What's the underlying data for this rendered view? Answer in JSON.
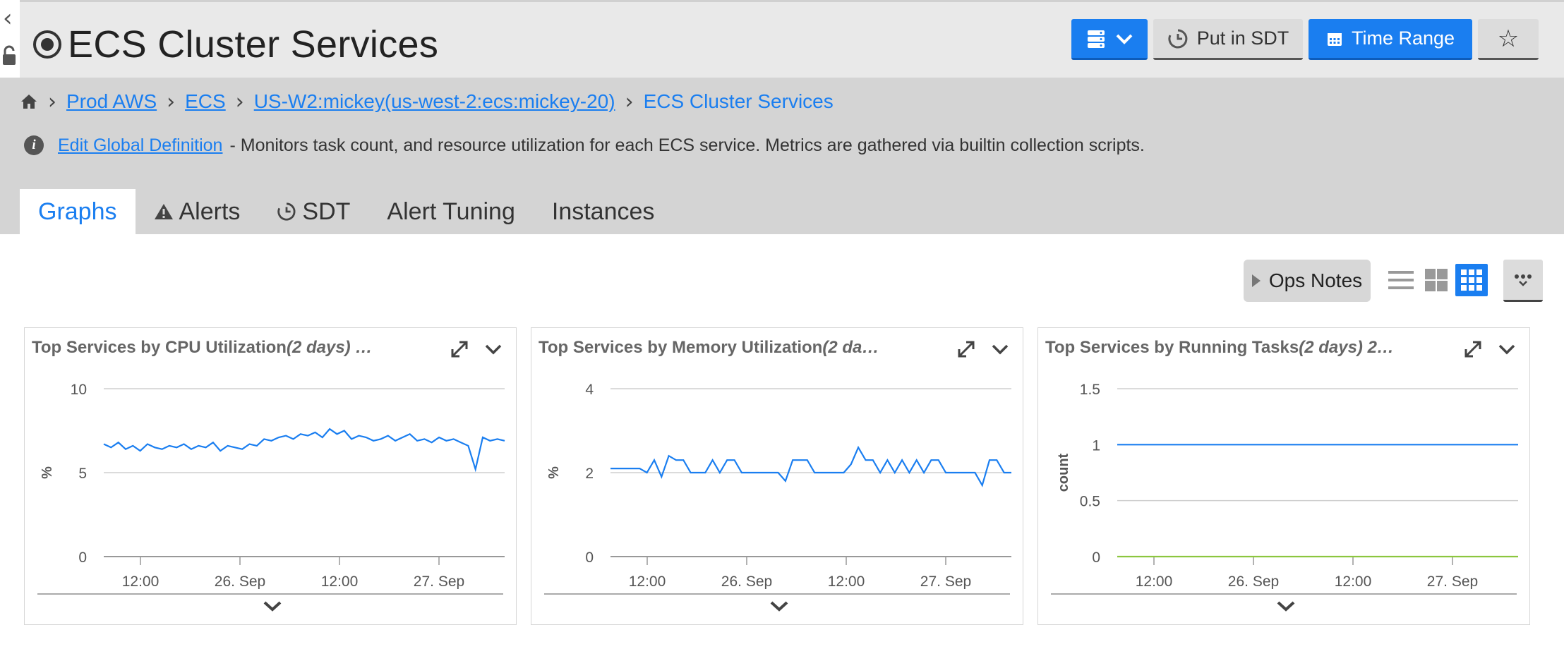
{
  "edge": {
    "collapse_icon": "chevron-left-icon",
    "lock_icon": "lock-icon"
  },
  "header": {
    "title": "ECS Cluster Services",
    "title_icon": "target-icon",
    "buttons": {
      "device_icon": "server-stack-icon",
      "sdt_label": "Put in SDT",
      "time_range_label": "Time Range",
      "favorite_glyph": "☆"
    }
  },
  "breadcrumb": {
    "home_icon": "home-icon",
    "items": [
      "Prod AWS",
      "ECS",
      "US-W2:mickey(us-west-2:ecs:mickey-20)"
    ],
    "current": "ECS Cluster Services"
  },
  "description": {
    "link": "Edit Global Definition",
    "text": "- Monitors task count, and resource utilization for each ECS service. Metrics are gathered via builtin collection scripts."
  },
  "tabs": [
    {
      "label": "Graphs",
      "active": true
    },
    {
      "label": "Alerts",
      "icon": "warning-icon"
    },
    {
      "label": "SDT",
      "icon": "sdt-clock-icon"
    },
    {
      "label": "Alert Tuning"
    },
    {
      "label": "Instances"
    }
  ],
  "toolbar": {
    "ops_notes_label": "Ops Notes"
  },
  "colors": {
    "accent": "#1a7ef0",
    "series_blue": "#1a7ef0",
    "series_green": "#8cc63f",
    "header_bg": "#e9e9e9",
    "crumb_bg": "#d4d4d4"
  },
  "cards": [
    {
      "title": "Top Services by CPU Utilization",
      "title_italic": "(2 days) …"
    },
    {
      "title": "Top Services by Memory Utilization",
      "title_italic": "(2 da…"
    },
    {
      "title": "Top Services by Running Tasks",
      "title_italic": "(2 days) 2…"
    }
  ],
  "chart_data": [
    {
      "type": "line",
      "ylabel": "%",
      "yticks": [
        "0",
        "5",
        "10"
      ],
      "ylim": [
        0,
        10
      ],
      "xticks": [
        "12:00",
        "26. Sep",
        "12:00",
        "27. Sep"
      ],
      "series": [
        {
          "values": [
            6.7,
            6.5,
            6.8,
            6.4,
            6.6,
            6.3,
            6.7,
            6.5,
            6.4,
            6.6,
            6.5,
            6.7,
            6.4,
            6.6,
            6.5,
            6.8,
            6.3,
            6.6,
            6.5,
            6.4,
            6.7,
            6.6,
            7.0,
            6.9,
            7.1,
            7.2,
            7.0,
            7.3,
            7.2,
            7.4,
            7.1,
            7.6,
            7.3,
            7.5,
            7.0,
            7.2,
            7.1,
            6.9,
            7.0,
            7.2,
            6.9,
            7.1,
            7.3,
            6.9,
            7.0,
            6.8,
            7.1,
            6.9,
            7.0,
            6.8,
            6.6,
            5.2,
            7.1,
            6.9,
            7.0,
            6.9
          ]
        }
      ]
    },
    {
      "type": "line",
      "ylabel": "%",
      "yticks": [
        "0",
        "2",
        "4"
      ],
      "ylim": [
        0,
        4
      ],
      "xticks": [
        "12:00",
        "26. Sep",
        "12:00",
        "27. Sep"
      ],
      "series": [
        {
          "values": [
            2.1,
            2.1,
            2.1,
            2.1,
            2.1,
            2.0,
            2.3,
            1.9,
            2.4,
            2.3,
            2.3,
            2.0,
            2.0,
            2.0,
            2.3,
            2.0,
            2.3,
            2.3,
            2.0,
            2.0,
            2.0,
            2.0,
            2.0,
            2.0,
            1.8,
            2.3,
            2.3,
            2.3,
            2.0,
            2.0,
            2.0,
            2.0,
            2.0,
            2.2,
            2.6,
            2.3,
            2.3,
            2.0,
            2.3,
            2.0,
            2.3,
            2.0,
            2.3,
            2.0,
            2.3,
            2.3,
            2.0,
            2.0,
            2.0,
            2.0,
            2.0,
            1.7,
            2.3,
            2.3,
            2.0,
            2.0
          ]
        }
      ]
    },
    {
      "type": "line",
      "ylabel": "count",
      "yticks": [
        "0",
        "0.5",
        "1",
        "1.5"
      ],
      "ylim": [
        0,
        1.5
      ],
      "xticks": [
        "12:00",
        "26. Sep",
        "12:00",
        "27. Sep"
      ],
      "series": [
        {
          "values": [
            1,
            1,
            1,
            1,
            1,
            1,
            1,
            1,
            1,
            1,
            1,
            1,
            1,
            1,
            1,
            1
          ],
          "color": "#1a7ef0"
        },
        {
          "values": [
            0,
            0,
            0,
            0,
            0,
            0,
            0,
            0,
            0,
            0,
            0,
            0,
            0,
            0,
            0,
            0
          ],
          "color": "#8cc63f"
        }
      ]
    }
  ]
}
